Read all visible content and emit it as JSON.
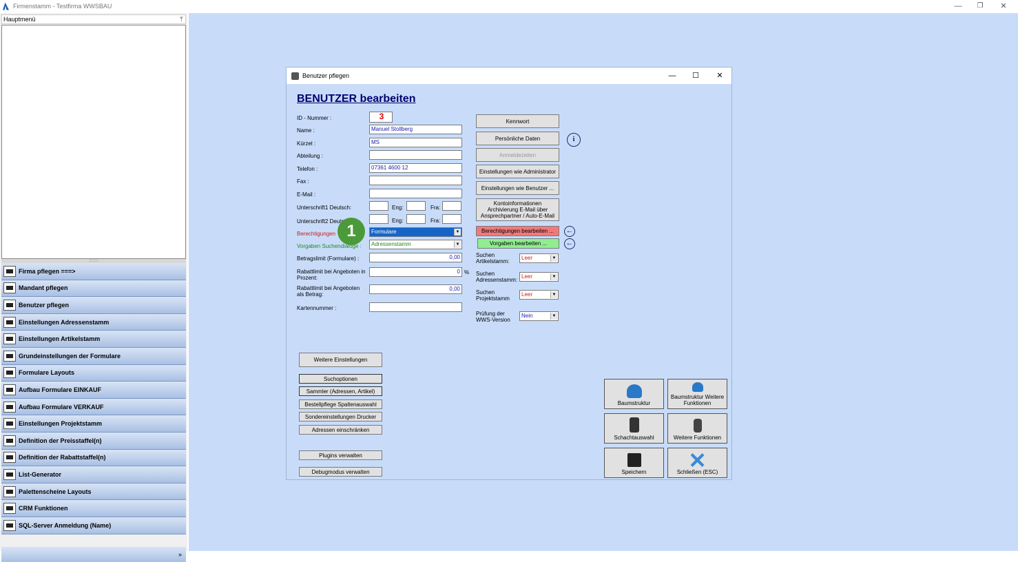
{
  "window": {
    "title": "Firmenstamm - Testfirma WWSBAU",
    "minimize": "—",
    "restore": "❐",
    "close": "✕"
  },
  "sidebar": {
    "header": "Hauptmenü",
    "pin": "ᛘ",
    "splitter": "::::::::",
    "items": [
      {
        "label": "Firma pflegen   ===>"
      },
      {
        "label": "Mandant pflegen"
      },
      {
        "label": "Benutzer pflegen"
      },
      {
        "label": "Einstellungen Adressenstamm"
      },
      {
        "label": "Einstellungen Artikelstamm"
      },
      {
        "label": "Grundeinstellungen der Formulare"
      },
      {
        "label": "Formulare Layouts"
      },
      {
        "label": "Aufbau Formulare EINKAUF"
      },
      {
        "label": "Aufbau Formulare VERKAUF"
      },
      {
        "label": "Einstellungen Projektstamm"
      },
      {
        "label": "Definition der Preisstaffel(n)"
      },
      {
        "label": "Definition der Rabattstaffel(n)"
      },
      {
        "label": "List-Generator"
      },
      {
        "label": "Palettenscheine Layouts"
      },
      {
        "label": "CRM Funktionen"
      },
      {
        "label": "SQL-Server Anmeldung (Name)"
      }
    ],
    "footer": "»"
  },
  "dialog": {
    "title": "Benutzer pflegen",
    "minimize": "—",
    "maximize": "☐",
    "close": "✕",
    "heading": "BENUTZER bearbeiten",
    "labels": {
      "id": "ID - Nummer :",
      "name": "Name :",
      "kuerzel": "Kürzel :",
      "abteilung": "Abteilung :",
      "telefon": "Telefon :",
      "fax": "Fax :",
      "email": "E-Mail :",
      "u1": "Unterschrift1 Deutsch:",
      "u2": "Unterschrift2 Deutsch:",
      "eng": "Eng:",
      "fra": "Fra:",
      "berechtigungen": "Berechtigungen",
      "vorgaben": "Vorgaben Suchendialoge :",
      "betragslimit": "Betragslimit (Formulare) :",
      "rabatt_prozent": "Rabattlimit bei Angeboten in Prozent:",
      "rabatt_betrag": "Rabattlimit bei Angeboten als Betrag:",
      "kartennummer": "Kartennummer :",
      "percent": "%",
      "s_artikel": "Suchen Artikelstamm:",
      "s_adressen": "Suchen Adressenstamm:",
      "s_projekt": "Suchen Projektstamm",
      "pruefung": "Prüfung der WWS-Version"
    },
    "values": {
      "id": "3",
      "name": "Manuel Stollberg",
      "kuerzel": "MS",
      "abteilung": "",
      "telefon": "07361 4600 12",
      "fax": "",
      "email": "",
      "berechtigungen": "Formulare",
      "vorgaben": "Adressenstamm",
      "betragslimit": "0,00",
      "rabatt_prozent": "0",
      "rabatt_betrag": "0,00",
      "kartennummer": "",
      "s_artikel": "Leer",
      "s_adressen": "Leer",
      "s_projekt": "Leer",
      "pruefung": "Nein",
      "arrow": "▼"
    },
    "buttons": {
      "kennwort": "Kennwort",
      "persoenlich": "Persönliche Daten",
      "anmeldezeiten": "Anmeldezeiten",
      "wie_admin": "Einstellungen wie Administrator",
      "wie_benutzer": "Einstellungen wie Benutzer ...",
      "konto": "Kontoinformationen Archivierung E-Mail über Ansprechpartner / Auto-E-Mail",
      "berechtigungen": "Berechtigungen bearbeiten ...",
      "vorgaben": "Vorgaben bearbeiten ...",
      "weitere_einst": "Weitere Einstellungen",
      "suchoptionen": "Suchoptionen",
      "sammler": "Sammler (Adressen, Artikel)",
      "bestellpflege": "Bestellpflege Spaltenauswahl",
      "sonder": "Sondereinstellungen Drucker",
      "adressen": "Adressen einschränken",
      "plugins": "Plugins verwalten",
      "debug": "Debugmodus verwalten",
      "baum": "Baumstruktur",
      "baum_weitere": "Baumstruktur Weitere Funktionen",
      "schacht": "Schachtauswahl",
      "weitere_fkt": "Weitere Funktionen",
      "speichern": "Speichern",
      "schliessen": "Schließen (ESC)"
    },
    "info_glyph": "i",
    "back_glyph": "←",
    "badge": "1"
  }
}
